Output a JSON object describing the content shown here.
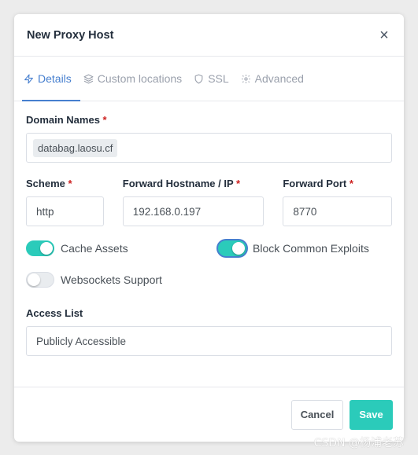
{
  "dialog": {
    "title": "New Proxy Host",
    "close_glyph": "×"
  },
  "tabs": [
    {
      "label": "Details",
      "icon": "lightning-icon",
      "active": true
    },
    {
      "label": "Custom locations",
      "icon": "layers-icon",
      "active": false
    },
    {
      "label": "SSL",
      "icon": "shield-icon",
      "active": false
    },
    {
      "label": "Advanced",
      "icon": "gear-icon",
      "active": false
    }
  ],
  "form": {
    "domain_names": {
      "label": "Domain Names",
      "required": "*",
      "chips": [
        "databag.laosu.cf"
      ]
    },
    "scheme": {
      "label": "Scheme",
      "required": "*",
      "value": "http"
    },
    "forward_hostname": {
      "label": "Forward Hostname / IP",
      "required": "*",
      "value": "192.168.0.197"
    },
    "forward_port": {
      "label": "Forward Port",
      "required": "*",
      "value": "8770"
    },
    "cache_assets": {
      "label": "Cache Assets",
      "on": true
    },
    "block_exploits": {
      "label": "Block Common Exploits",
      "on": true
    },
    "websockets": {
      "label": "Websockets Support",
      "on": false
    },
    "access_list": {
      "label": "Access List",
      "value": "Publicly Accessible"
    }
  },
  "footer": {
    "cancel_label": "Cancel",
    "save_label": "Save"
  },
  "watermark": "CSDN @杨浦老苏",
  "colors": {
    "accent": "#467fcf",
    "toggle_on": "#2bcbba",
    "required": "#cd201f"
  }
}
